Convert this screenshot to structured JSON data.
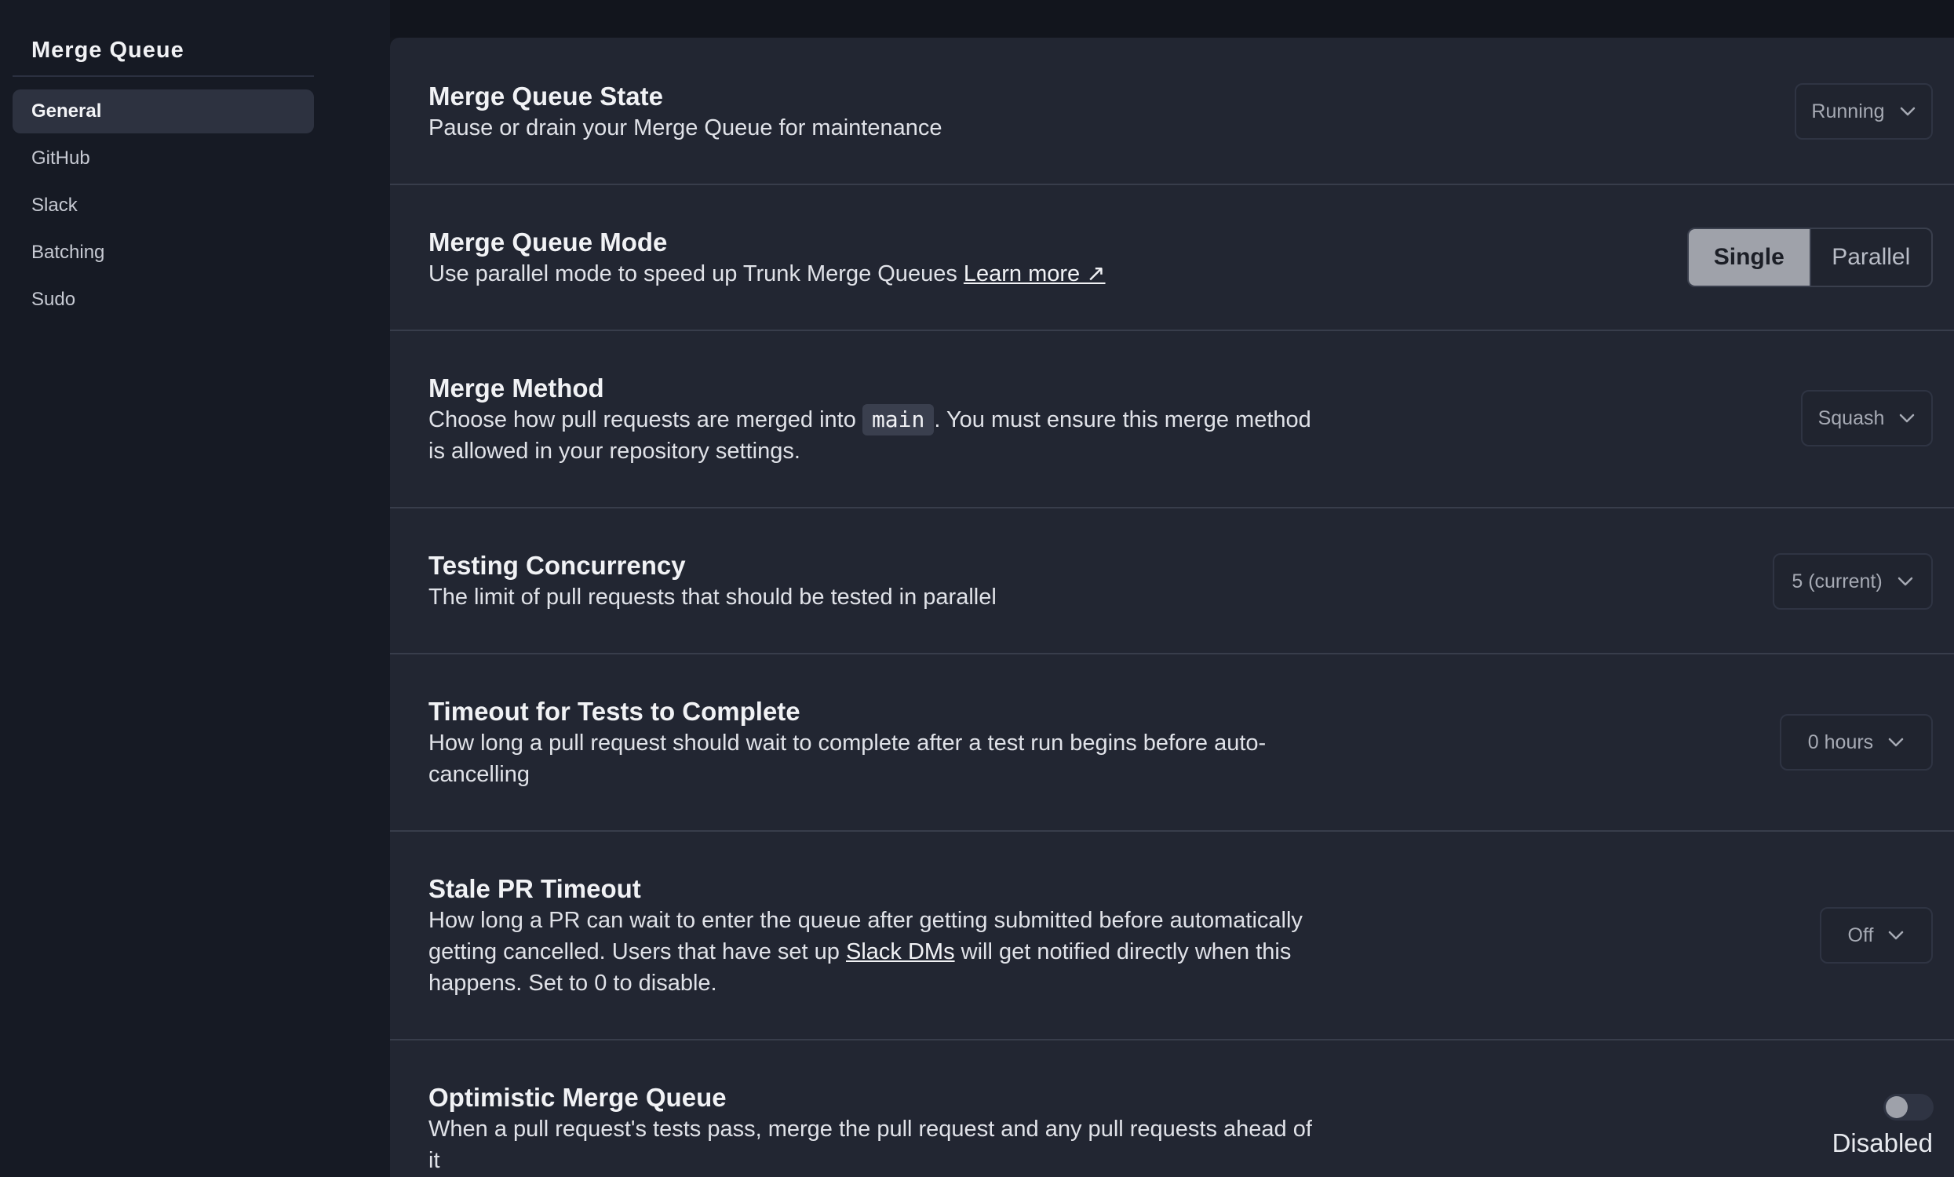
{
  "sidebar": {
    "title": "Merge Queue",
    "items": [
      {
        "label": "General",
        "active": true
      },
      {
        "label": "GitHub",
        "active": false
      },
      {
        "label": "Slack",
        "active": false
      },
      {
        "label": "Batching",
        "active": false
      },
      {
        "label": "Sudo",
        "active": false
      }
    ]
  },
  "settings": {
    "state": {
      "title": "Merge Queue State",
      "description": "Pause or drain your Merge Queue for maintenance",
      "value": "Running"
    },
    "mode": {
      "title": "Merge Queue Mode",
      "description": "Use parallel mode to speed up Trunk Merge Queues",
      "link_label": "Learn more ↗",
      "options": [
        "Single",
        "Parallel"
      ],
      "selected": "Single"
    },
    "method": {
      "title": "Merge Method",
      "description_before": "Choose how pull requests are merged into",
      "branch": "main",
      "description_after": ". You must ensure this merge method is allowed in your repository settings.",
      "value": "Squash"
    },
    "concurrency": {
      "title": "Testing Concurrency",
      "description": "The limit of pull requests that should be tested in parallel",
      "value": "5 (current)"
    },
    "timeout": {
      "title": "Timeout for Tests to Complete",
      "description": "How long a pull request should wait to complete after a test run begins before auto-cancelling",
      "value": "0 hours"
    },
    "stale": {
      "title": "Stale PR Timeout",
      "description_before": "How long a PR can wait to enter the queue after getting submitted before automatically getting cancelled. Users that have set up",
      "link_label": "Slack DMs",
      "description_after": "will get notified directly when this happens. Set to 0 to disable.",
      "value": "Off"
    },
    "optimistic": {
      "title": "Optimistic Merge Queue",
      "description": "When a pull request's tests pass, merge the pull request and any pull requests ahead of it",
      "enabled": false,
      "status_label": "Disabled"
    }
  },
  "icons": {
    "dropdown": "chevron-down-icon"
  },
  "colors": {
    "background": "#14171f",
    "sidebar": "#161a24",
    "panel": "#222632",
    "active_nav": "#2d3240",
    "segment_active": "#9fa2aa"
  }
}
